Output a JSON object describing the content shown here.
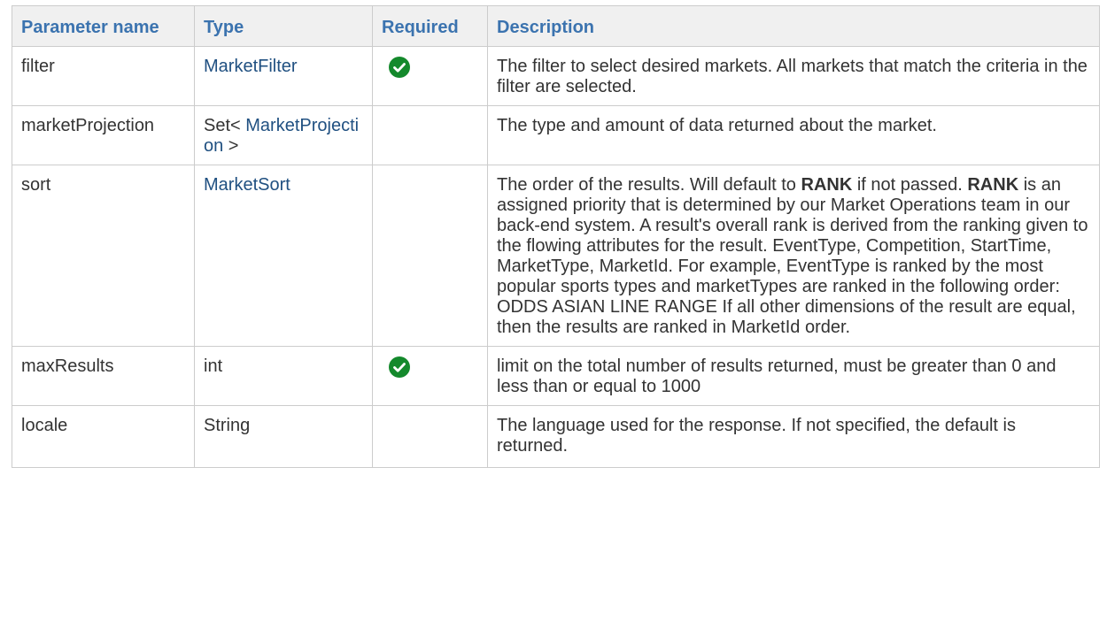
{
  "headers": {
    "param": "Parameter name",
    "type": "Type",
    "required": "Required",
    "description": "Description"
  },
  "colors": {
    "header_text": "#3b73af",
    "header_bg": "#f0f0f0",
    "link": "#205081",
    "check_green": "#14892c",
    "border": "#cccccc"
  },
  "rows": [
    {
      "name": "filter",
      "type_link": "MarketFilter",
      "required": true,
      "required_icon": "check-circle-icon",
      "description": "The filter to select desired markets. All markets that match the criteria in the filter are selected."
    },
    {
      "name": "marketProjection",
      "type_prefix": "Set< ",
      "type_link": "MarketProjection",
      "type_suffix": " >",
      "required": false,
      "description": "The type and amount of data returned about the market."
    },
    {
      "name": "sort",
      "type_link": "MarketSort",
      "required": false,
      "description_part1": "The order of the results. Will default to ",
      "description_bold1": "RANK",
      "description_part2": " if not passed. ",
      "description_bold2": "RANK",
      "description_part3": " is an assigned priority that is determined by our Market Operations team in our back-end system. A result's overall rank is derived from the ranking given to the flowing attributes for the result. EventType, Competition, StartTime, MarketType, MarketId. For example, EventType is ranked by the most popular sports types and marketTypes are ranked in the following order: ODDS ASIAN LINE RANGE If all other dimensions of the result are equal, then the results are ranked in MarketId order."
    },
    {
      "name": "maxResults",
      "type_text": "int",
      "required": true,
      "required_icon": "check-circle-icon",
      "description": "limit on the total number of results returned, must be greater than 0 and less than or equal to 1000"
    },
    {
      "name": "locale",
      "type_text": "String",
      "required": false,
      "description": "The language used for the response. If not specified, the default is returned."
    }
  ]
}
